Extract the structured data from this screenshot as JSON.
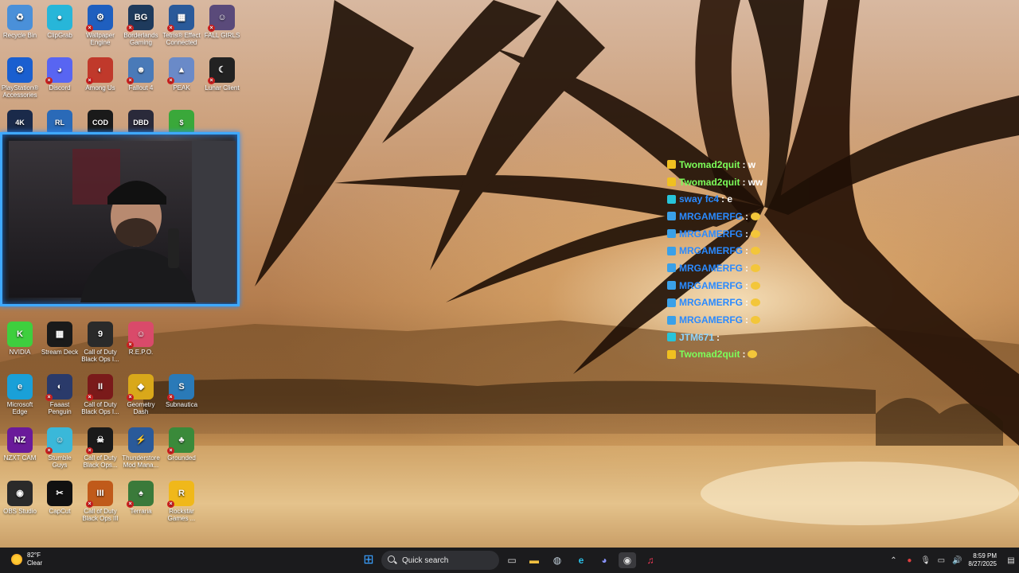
{
  "desktop": {
    "icons": [
      {
        "label": "Recycle Bin",
        "color": "#4a90d9",
        "glyph": "♻",
        "err": false,
        "col": 0,
        "row": 0
      },
      {
        "label": "ClipGrab",
        "color": "#27b6d9",
        "glyph": "●",
        "err": false,
        "col": 1,
        "row": 0
      },
      {
        "label": "Wallpaper Engine",
        "color": "#1f5fbf",
        "glyph": "⚙",
        "err": true,
        "col": 2,
        "row": 0
      },
      {
        "label": "Borderlands Gaming",
        "color": "#1e3a5c",
        "glyph": "BG",
        "err": true,
        "col": 3,
        "row": 0
      },
      {
        "label": "Tetris® Effect Connected",
        "color": "#2a5a9a",
        "glyph": "▦",
        "err": true,
        "col": 4,
        "row": 0
      },
      {
        "label": "FALL GIRLS",
        "color": "#5a4a7a",
        "glyph": "☺",
        "err": true,
        "col": 5,
        "row": 0
      },
      {
        "label": "PlayStation® Accessories",
        "color": "#1a5fd0",
        "glyph": "⚙",
        "err": false,
        "col": 0,
        "row": 1
      },
      {
        "label": "Discord",
        "color": "#5865f2",
        "glyph": "◕",
        "err": true,
        "col": 1,
        "row": 1
      },
      {
        "label": "Among Us",
        "color": "#c0392b",
        "glyph": "◐",
        "err": true,
        "col": 2,
        "row": 1
      },
      {
        "label": "Fallout 4",
        "color": "#4a7ab8",
        "glyph": "☻",
        "err": true,
        "col": 3,
        "row": 1
      },
      {
        "label": "PEAK",
        "color": "#6a8ac8",
        "glyph": "▲",
        "err": true,
        "col": 4,
        "row": 1
      },
      {
        "label": "Lunar Client",
        "color": "#222222",
        "glyph": "☾",
        "err": true,
        "col": 5,
        "row": 1
      },
      {
        "label": "NVIDIA",
        "color": "#3ecf3e",
        "glyph": "K",
        "err": false,
        "col": 0,
        "row": 6
      },
      {
        "label": "Stream Deck",
        "color": "#1a1a1a",
        "glyph": "▦",
        "err": false,
        "col": 1,
        "row": 6
      },
      {
        "label": "Call of Duty Black Ops I...",
        "color": "#2a2a2a",
        "glyph": "9",
        "err": false,
        "col": 2,
        "row": 6
      },
      {
        "label": "R.E.P.O.",
        "color": "#d94a6a",
        "glyph": "☺",
        "err": true,
        "col": 3,
        "row": 6
      },
      {
        "label": "Microsoft Edge",
        "color": "#1aa0d8",
        "glyph": "e",
        "err": false,
        "col": 0,
        "row": 7
      },
      {
        "label": "Faaast Penguin",
        "color": "#2a3a6a",
        "glyph": "◐",
        "err": true,
        "col": 1,
        "row": 7
      },
      {
        "label": "Call of Duty Black Ops I...",
        "color": "#7a1a1a",
        "glyph": "II",
        "err": true,
        "col": 2,
        "row": 7
      },
      {
        "label": "Geometry Dash",
        "color": "#d9a81a",
        "glyph": "◆",
        "err": true,
        "col": 3,
        "row": 7
      },
      {
        "label": "Subnautica",
        "color": "#2a7ab8",
        "glyph": "S",
        "err": true,
        "col": 4,
        "row": 7
      },
      {
        "label": "NZXT CAM",
        "color": "#6a1a9a",
        "glyph": "NZ",
        "err": false,
        "col": 0,
        "row": 8
      },
      {
        "label": "Stumble Guys",
        "color": "#3ab8d9",
        "glyph": "☺",
        "err": true,
        "col": 1,
        "row": 8
      },
      {
        "label": "Call of Duty Black Ops...",
        "color": "#1a1a1a",
        "glyph": "☠",
        "err": true,
        "col": 2,
        "row": 8
      },
      {
        "label": "Thunderstore Mod Mana...",
        "color": "#2a5a9a",
        "glyph": "⚡",
        "err": false,
        "col": 3,
        "row": 8
      },
      {
        "label": "Grounded",
        "color": "#3a8a3a",
        "glyph": "♣",
        "err": true,
        "col": 4,
        "row": 8
      },
      {
        "label": "OBS Studio",
        "color": "#2a2a2a",
        "glyph": "◉",
        "err": false,
        "col": 0,
        "row": 9
      },
      {
        "label": "CapCut",
        "color": "#111111",
        "glyph": "✂",
        "err": false,
        "col": 1,
        "row": 9
      },
      {
        "label": "Call of Duty Black Ops III",
        "color": "#c05a1a",
        "glyph": "III",
        "err": true,
        "col": 2,
        "row": 9
      },
      {
        "label": "Terraria",
        "color": "#3a7a3a",
        "glyph": "♠",
        "err": true,
        "col": 3,
        "row": 9
      },
      {
        "label": "Rockstar Games ...",
        "color": "#f0b81a",
        "glyph": "R",
        "err": true,
        "col": 4,
        "row": 9
      }
    ],
    "partial_row": [
      {
        "label": "4K",
        "color": "#1a2a4a",
        "col": 0
      },
      {
        "label": "RL",
        "color": "#2a6ab8",
        "col": 1
      },
      {
        "label": "COD",
        "color": "#1a1a1a",
        "col": 2
      },
      {
        "label": "DBD",
        "color": "#2a2a3a",
        "col": 3
      },
      {
        "label": "$",
        "color": "#3aa83a",
        "col": 4
      }
    ]
  },
  "webcam": {
    "border_color": "#3fa9ff"
  },
  "chat": {
    "messages": [
      {
        "user": "Twomad2quit",
        "text": ": w",
        "color": "#7cff5a",
        "badge": "#f0c020",
        "emoji": false
      },
      {
        "user": "Twomad2quit",
        "text": ": ww",
        "color": "#7cff5a",
        "badge": "#f0c020",
        "emoji": false
      },
      {
        "user": "sway fc4",
        "text": ": e",
        "color": "#2a8aff",
        "badge": "#27c4d9",
        "emoji": false
      },
      {
        "user": "MRGAMERFG",
        "text": ":",
        "color": "#2a8aff",
        "badge": "#3aa0e8",
        "emoji": true
      },
      {
        "user": "MRGAMERFG",
        "text": ":",
        "color": "#2a8aff",
        "badge": "#3aa0e8",
        "emoji": true
      },
      {
        "user": "MRGAMERFG",
        "text": ":",
        "color": "#2a8aff",
        "badge": "#3aa0e8",
        "emoji": true
      },
      {
        "user": "MRGAMERFG",
        "text": ":",
        "color": "#2a8aff",
        "badge": "#3aa0e8",
        "emoji": true
      },
      {
        "user": "MRGAMERFG",
        "text": ":",
        "color": "#2a8aff",
        "badge": "#3aa0e8",
        "emoji": true
      },
      {
        "user": "MRGAMERFG",
        "text": ":",
        "color": "#2a8aff",
        "badge": "#3aa0e8",
        "emoji": true
      },
      {
        "user": "MRGAMERFG",
        "text": ":",
        "color": "#2a8aff",
        "badge": "#3aa0e8",
        "emoji": true
      },
      {
        "user": "JTM671",
        "text": ":",
        "color": "#8fd6ff",
        "badge": "#27c4d9",
        "emoji": false
      },
      {
        "user": "Twomad2quit",
        "text": ":",
        "color": "#7cff5a",
        "badge": "#f0c020",
        "emoji": true
      }
    ]
  },
  "taskbar": {
    "weather": {
      "temp": "82°F",
      "condition": "Clear"
    },
    "search_placeholder": "Quick search",
    "apps": [
      {
        "name": "start-icon",
        "glyph": "⊞",
        "color": "#3aa0ff"
      },
      {
        "name": "task-view-icon",
        "glyph": "▭",
        "color": "#dddddd"
      },
      {
        "name": "file-explorer-icon",
        "glyph": "▬",
        "color": "#f0c040"
      },
      {
        "name": "steam-icon",
        "glyph": "◍",
        "color": "#c7d5e0"
      },
      {
        "name": "edge-icon",
        "glyph": "e",
        "color": "#2ac0e8"
      },
      {
        "name": "discord-icon",
        "glyph": "◕",
        "color": "#8a94ff"
      },
      {
        "name": "obs-icon",
        "glyph": "◉",
        "color": "#dddddd"
      },
      {
        "name": "music-icon",
        "glyph": "♫",
        "color": "#ff3a5a"
      }
    ],
    "tray": {
      "time": "8:59 PM",
      "date": "8/27/2025"
    }
  }
}
